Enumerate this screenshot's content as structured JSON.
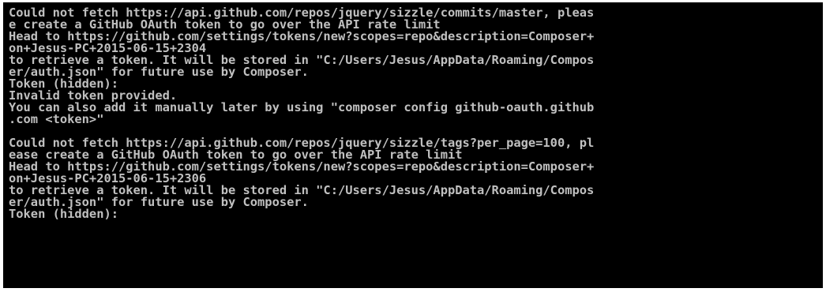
{
  "console": {
    "lines": [
      "Could not fetch https://api.github.com/repos/jquery/sizzle/commits/master, pleas",
      "e create a GitHub OAuth token to go over the API rate limit",
      "Head to https://github.com/settings/tokens/new?scopes=repo&description=Composer+",
      "on+Jesus-PC+2015-06-15+2304",
      "to retrieve a token. It will be stored in \"C:/Users/Jesus/AppData/Roaming/Compos",
      "er/auth.json\" for future use by Composer.",
      "Token (hidden):",
      "Invalid token provided.",
      "You can also add it manually later by using \"composer config github-oauth.github",
      ".com <token>\"",
      "",
      "Could not fetch https://api.github.com/repos/jquery/sizzle/tags?per_page=100, pl",
      "ease create a GitHub OAuth token to go over the API rate limit",
      "Head to https://github.com/settings/tokens/new?scopes=repo&description=Composer+",
      "on+Jesus-PC+2015-06-15+2306",
      "to retrieve a token. It will be stored in \"C:/Users/Jesus/AppData/Roaming/Compos",
      "er/auth.json\" for future use by Composer.",
      "Token (hidden):"
    ]
  },
  "colors": {
    "background": "#000000",
    "text": "#c0c0c0"
  }
}
